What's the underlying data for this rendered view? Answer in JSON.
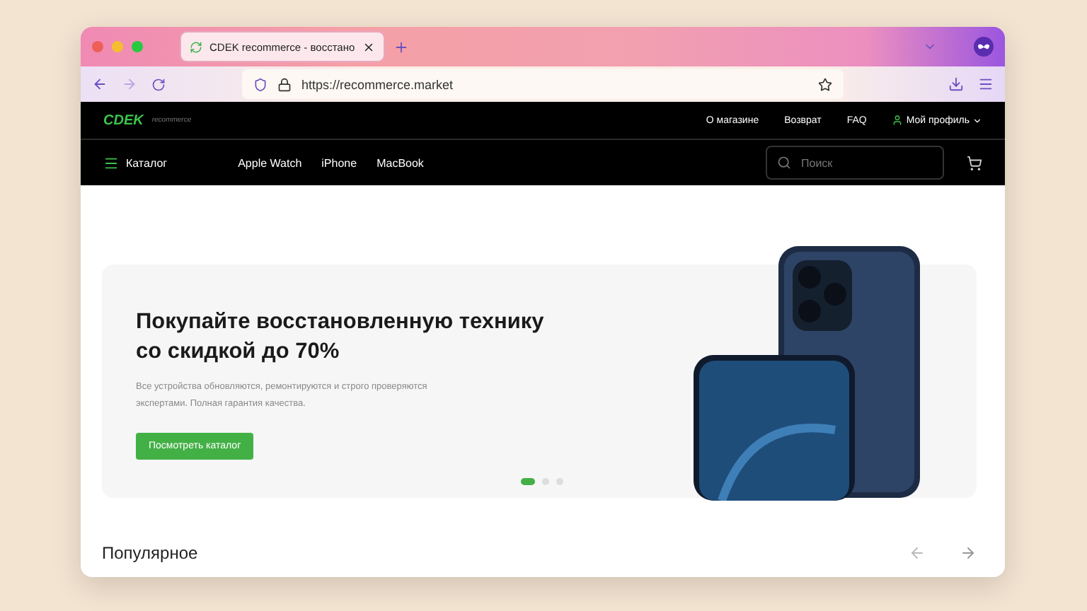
{
  "browser": {
    "tabs": [
      {
        "title": "CDEK recommerce - восстано",
        "selected": true
      }
    ],
    "url": "https://recommerce.market"
  },
  "header": {
    "logo": "CDEK",
    "logo_sub": "recommerce",
    "links": [
      "О магазине",
      "Возврат",
      "FAQ"
    ],
    "profile": "Мой профиль"
  },
  "nav": {
    "catalog": "Каталог",
    "items": [
      "Apple Watch",
      "iPhone",
      "MacBook"
    ],
    "search": {
      "placeholder": "Поиск"
    }
  },
  "hero": {
    "title": "Покупайте восстановленную технику со скидкой до 70%",
    "text": "Все устройства обновляются, ремонтируются и строго проверяются экспертами. Полная гарантия качества.",
    "button": "Посмотреть каталог",
    "slides": [
      {
        "selected": true
      },
      {
        "selected": false
      },
      {
        "selected": false
      }
    ]
  },
  "popular": {
    "title": "Популярное"
  }
}
